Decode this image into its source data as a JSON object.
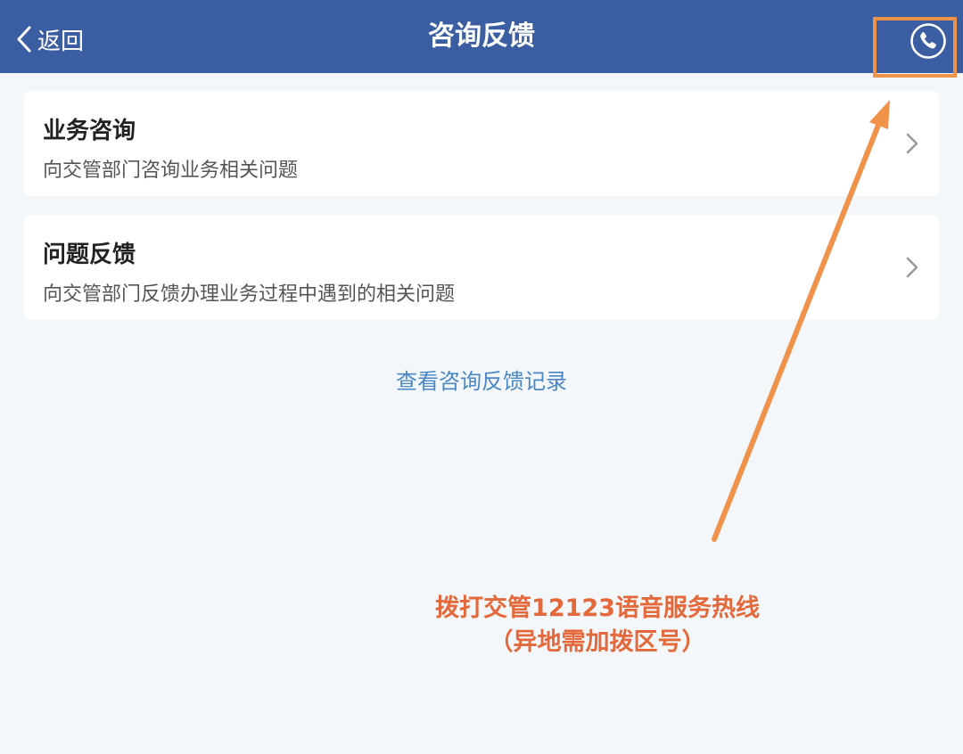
{
  "header": {
    "back_label": "返回",
    "title": "咨询反馈",
    "phone_icon": "phone-icon"
  },
  "cards": [
    {
      "title": "业务咨询",
      "desc": "向交管部门咨询业务相关问题"
    },
    {
      "title": "问题反馈",
      "desc": "向交管部门反馈办理业务过程中遇到的相关问题"
    }
  ],
  "records_link": "查看咨询反馈记录",
  "annotation": {
    "line1": "拨打交管12123语音服务热线",
    "line2": "（异地需加拨区号）",
    "color": "#e4683a",
    "arrow_color": "#f0924a"
  },
  "colors": {
    "header_bg": "#3b5ea2",
    "page_bg": "#f3f7fa",
    "link": "#4a87c4"
  }
}
